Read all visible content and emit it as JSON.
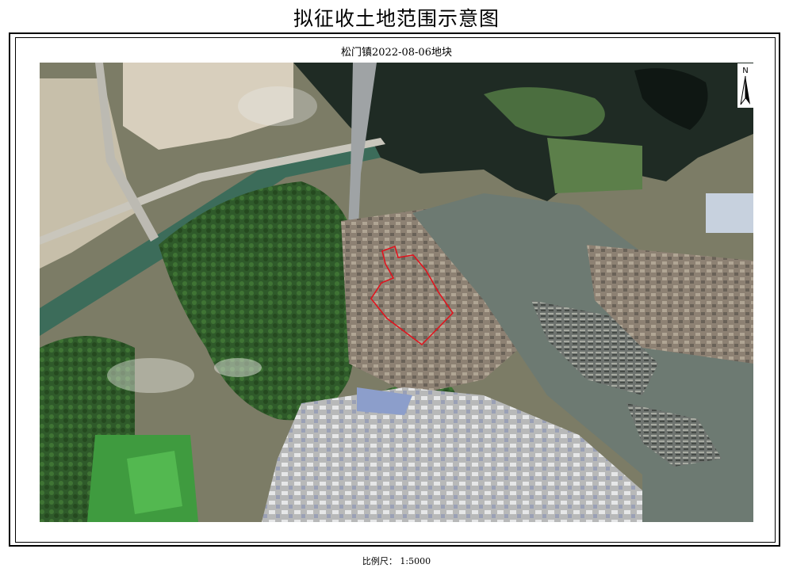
{
  "title": "拟征收土地范围示意图",
  "map": {
    "subtitle": "松门镇2022-08-06地块",
    "north_arrow_letter": "N",
    "parcel_outline_color": "#e0141e",
    "imagery": "satellite"
  },
  "scale": {
    "text": "比例尺： 1:5000"
  }
}
